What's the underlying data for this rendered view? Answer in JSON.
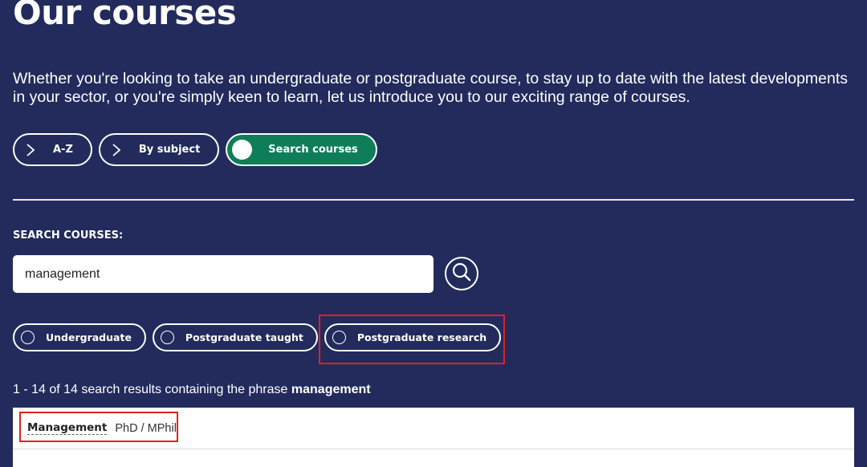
{
  "page": {
    "title": "Our courses",
    "intro": "Whether you're looking to take an undergraduate or postgraduate course, to stay up to date with the latest developments in your sector, or you're simply keen to learn, let us introduce you to our exciting range of courses."
  },
  "nav": {
    "items": [
      {
        "label": "A-Z",
        "icon": "chevron-right-icon"
      },
      {
        "label": "By subject",
        "icon": "chevron-right-icon"
      },
      {
        "label": "Search courses",
        "icon": "filled-circle-icon",
        "active": true
      }
    ]
  },
  "search": {
    "label": "SEARCH COURSES:",
    "value": "management",
    "button_icon": "search-icon"
  },
  "filters": {
    "items": [
      {
        "label": "Undergraduate",
        "selected": false
      },
      {
        "label": "Postgraduate taught",
        "selected": false
      },
      {
        "label": "Postgraduate research",
        "selected": false
      }
    ]
  },
  "results": {
    "summary_prefix": "1 - 14 of 14 search results containing the phrase",
    "summary_term": "management",
    "items": [
      {
        "title": "Management",
        "type": "PhD / MPhil"
      }
    ]
  },
  "colors": {
    "background": "#222b5c",
    "active_pill": "#0f7d5a",
    "highlight": "#e0221f"
  }
}
